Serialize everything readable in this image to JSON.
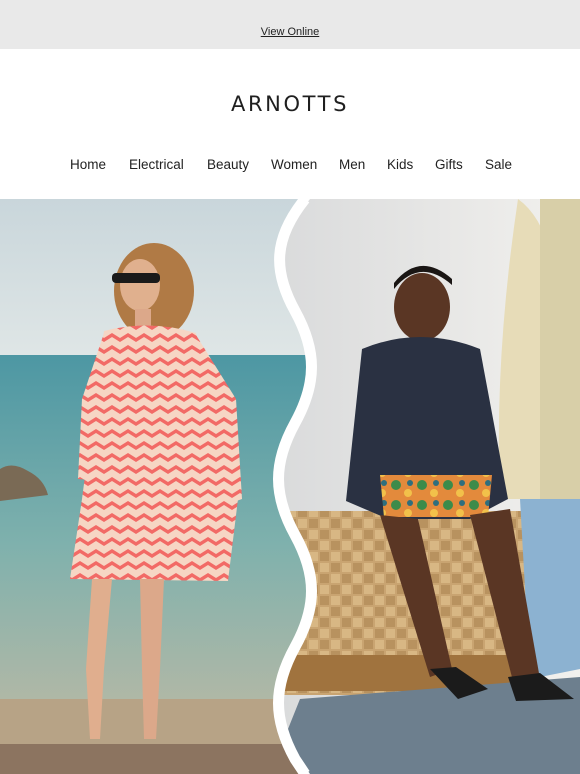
{
  "topbar": {
    "view_online": "View Online"
  },
  "brand": {
    "logo_text": "ARNOTTS"
  },
  "nav": {
    "items": [
      {
        "label": "Home"
      },
      {
        "label": "Electrical"
      },
      {
        "label": "Beauty"
      },
      {
        "label": "Women"
      },
      {
        "label": "Men"
      },
      {
        "label": "Kids"
      },
      {
        "label": "Gifts"
      },
      {
        "label": "Sale"
      }
    ]
  },
  "hero": {
    "left_panel": "woman-beach-photo",
    "right_panel": "man-seated-photo",
    "divider": "wavy-divider"
  },
  "colors": {
    "topbar_bg": "#e9e9e9",
    "dress_coral": "#f36f6a",
    "sea": "#4f9ea6",
    "jacket_navy": "#2a3142"
  }
}
